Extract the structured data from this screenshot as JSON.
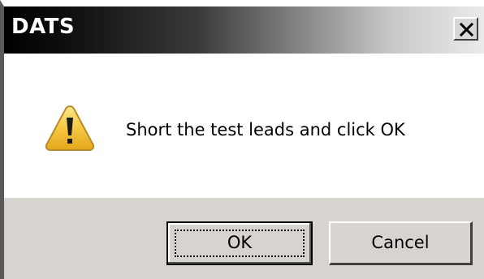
{
  "window": {
    "title": "DATS",
    "close_icon": "close-icon"
  },
  "message": {
    "icon": "warning-icon",
    "text": "Short the test leads and click OK"
  },
  "buttons": {
    "ok_label": "OK",
    "cancel_label": "Cancel"
  },
  "colors": {
    "footer_bg": "#d7d4cf",
    "warning_yellow": "#f2c63a"
  }
}
